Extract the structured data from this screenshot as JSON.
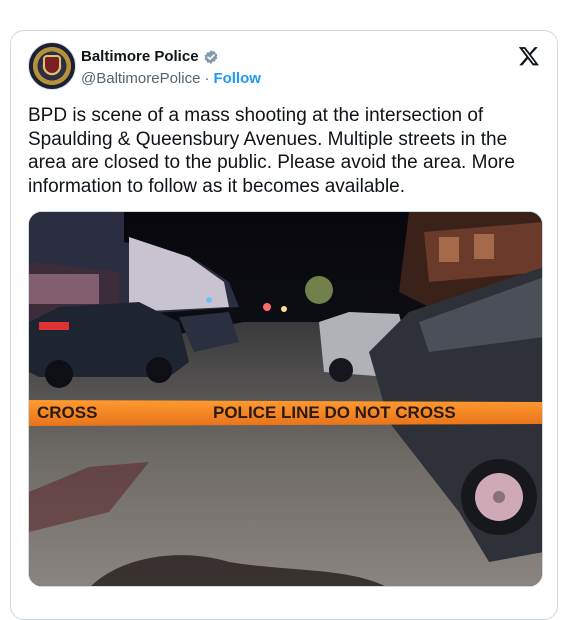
{
  "account": {
    "display_name": "Baltimore Police",
    "handle": "@BaltimorePolice",
    "separator": "·",
    "follow_label": "Follow",
    "verified": true
  },
  "tweet": {
    "text": "BPD is scene of a mass shooting at the intersection of Spaulding & Queensbury Avenues. Multiple streets in the area are closed to the public. Please avoid the area. More information to follow as it becomes available."
  },
  "media": {
    "tape_text_main": "POLICE LINE DO NOT CROSS",
    "tape_text_left": "CROSS",
    "tape_color": "#f5821f"
  },
  "icons": {
    "logo": "x-logo-icon",
    "badge": "verified-badge-icon"
  },
  "colors": {
    "accent": "#1d9bf0",
    "text": "#0f1419",
    "muted": "#536471"
  }
}
